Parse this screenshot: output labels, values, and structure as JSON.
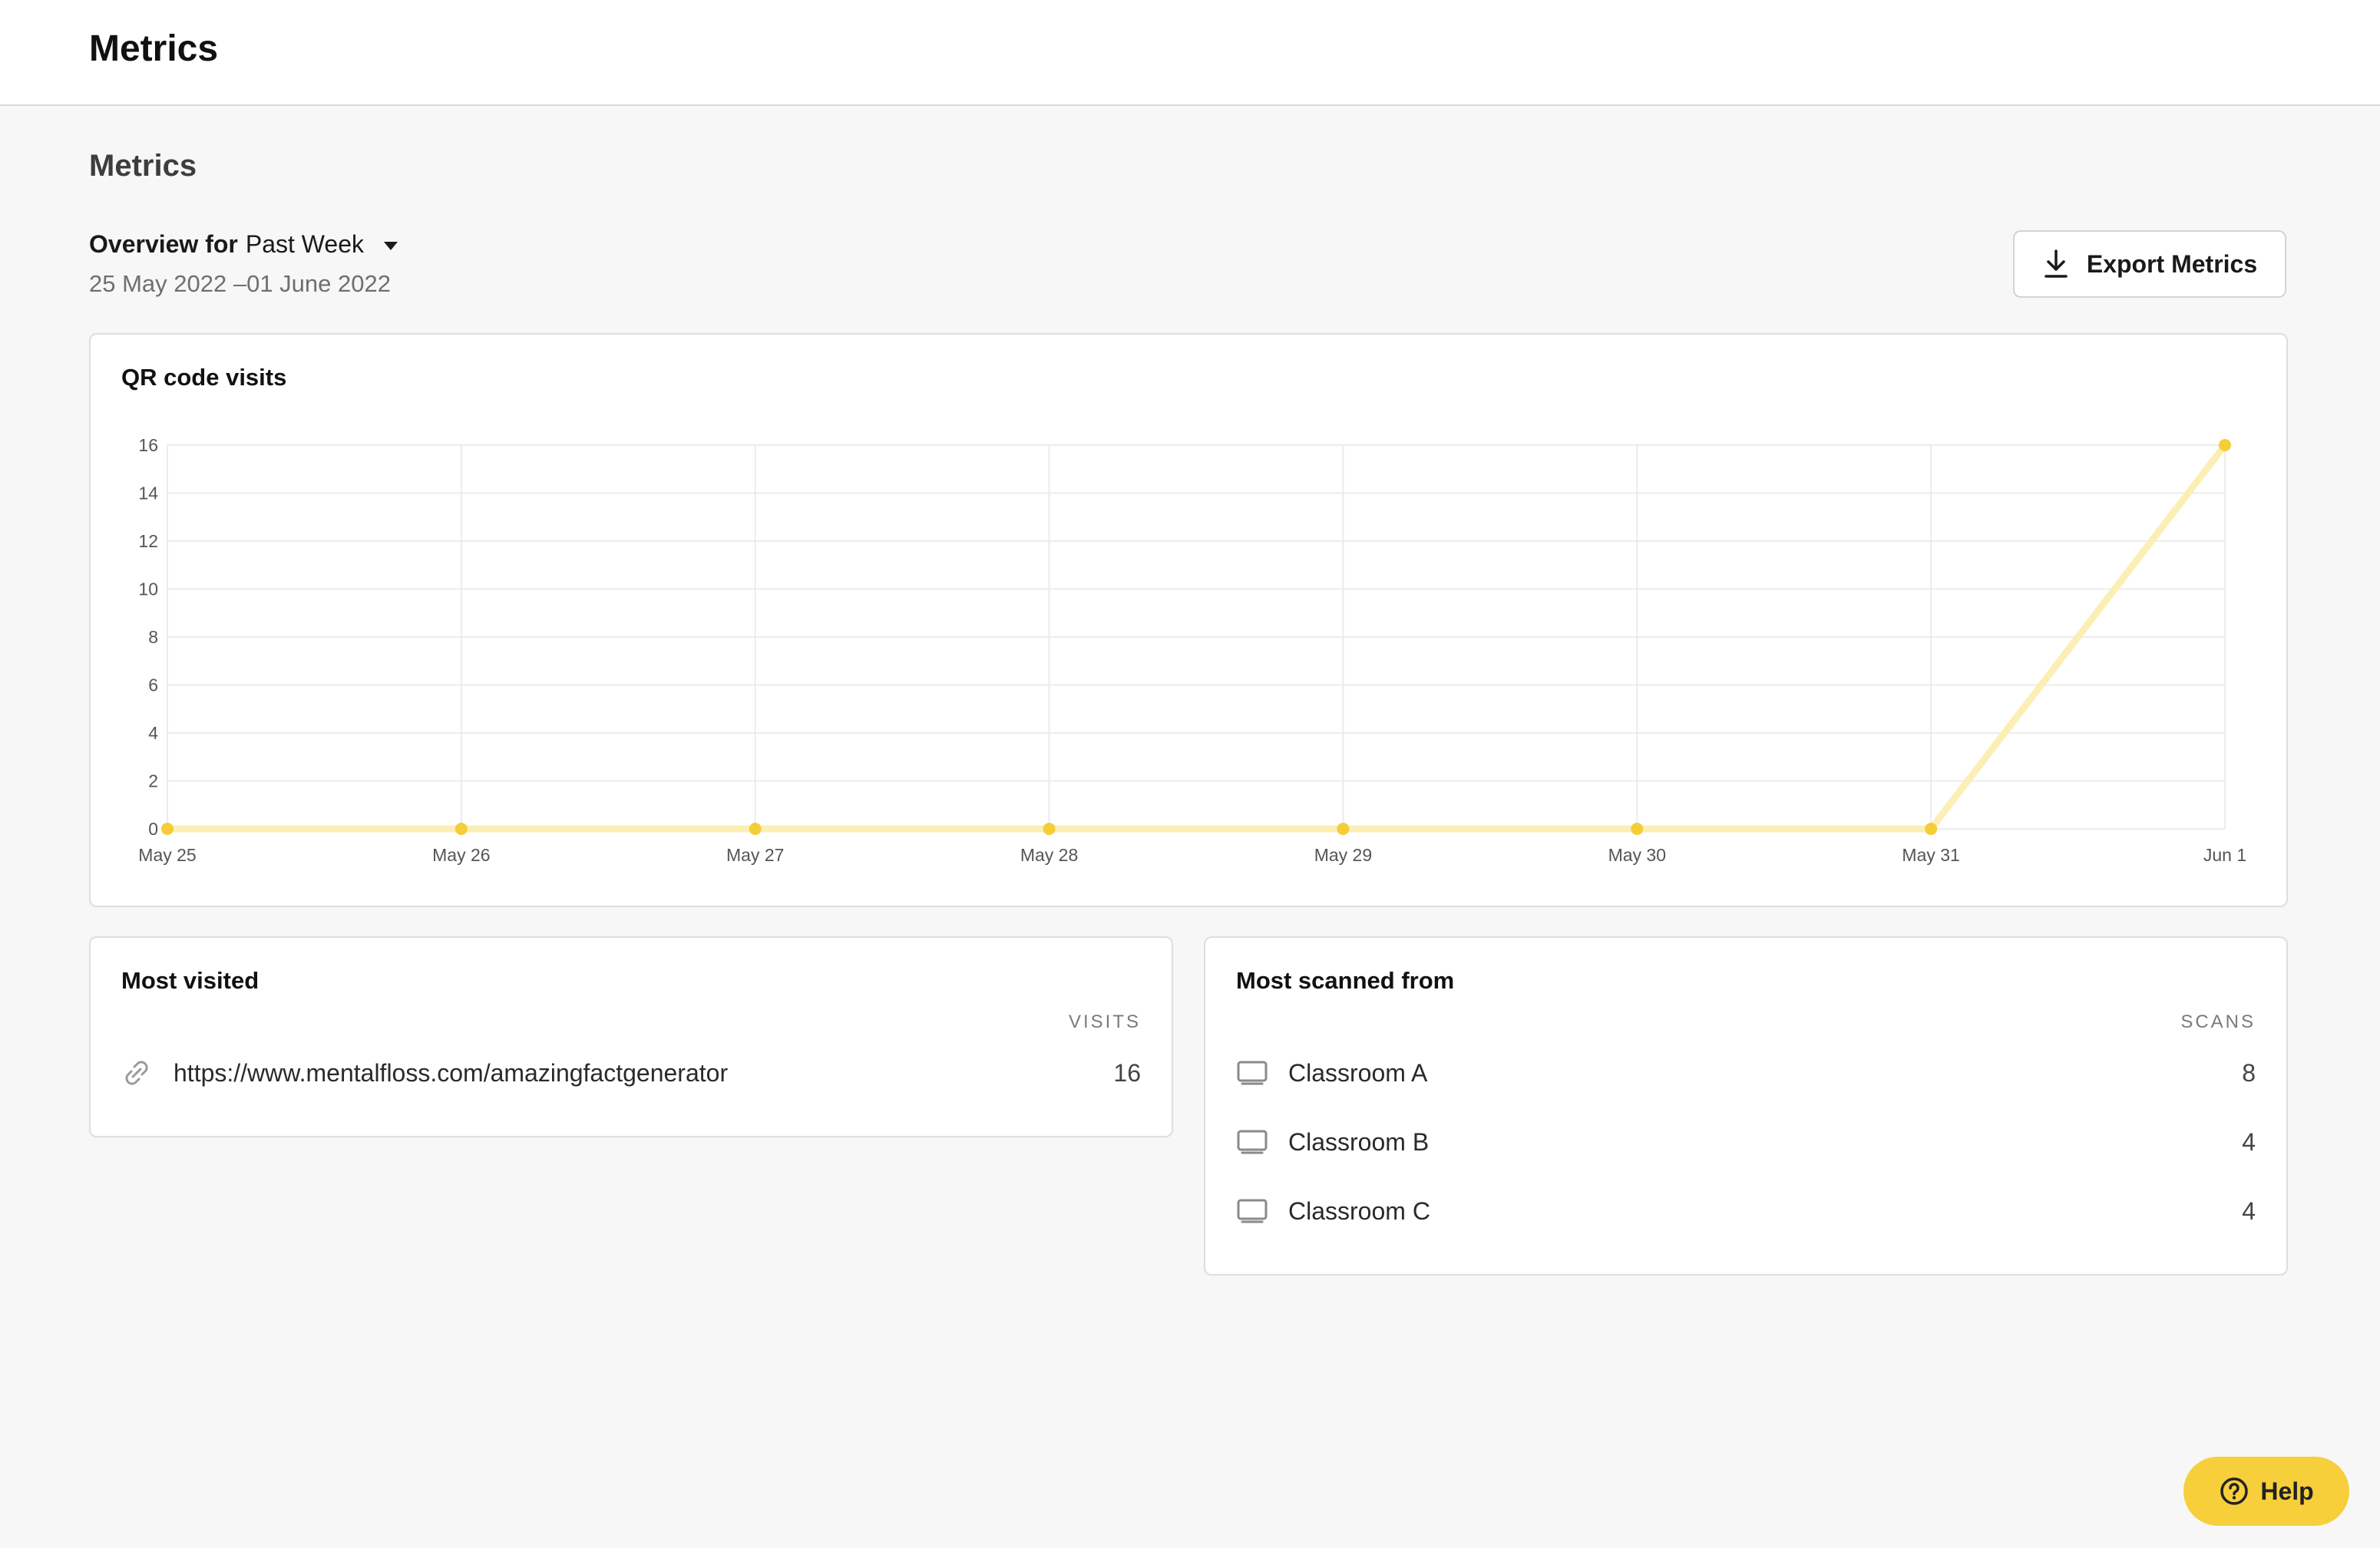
{
  "header": {
    "title": "Metrics"
  },
  "page": {
    "section_title": "Metrics",
    "overview_label": "Overview for",
    "period_selected": "Past Week",
    "date_range": "25 May 2022 –01 June 2022",
    "export_label": "Export Metrics"
  },
  "chart": {
    "title": "QR code visits"
  },
  "chart_data": {
    "type": "line",
    "title": "QR code visits",
    "xlabel": "",
    "ylabel": "",
    "categories": [
      "May 25",
      "May 26",
      "May 27",
      "May 28",
      "May 29",
      "May 30",
      "May 31",
      "Jun 1"
    ],
    "series": [
      {
        "values": [
          0,
          0,
          0,
          0,
          0,
          0,
          0,
          16
        ]
      }
    ],
    "ylim": [
      0,
      16
    ],
    "yticks": [
      0,
      2,
      4,
      6,
      8,
      10,
      12,
      14,
      16
    ],
    "grid": true,
    "legend": "none",
    "colors": {
      "line": "#fbefb5",
      "point": "#f5cd36"
    }
  },
  "most_visited": {
    "title": "Most visited",
    "column_header": "VISITS",
    "rows": [
      {
        "icon": "link-icon",
        "label": "https://www.mentalfloss.com/amazingfactgenerator",
        "value": "16"
      }
    ]
  },
  "most_scanned": {
    "title": "Most scanned from",
    "column_header": "SCANS",
    "rows": [
      {
        "icon": "display-icon",
        "label": "Classroom A",
        "value": "8"
      },
      {
        "icon": "display-icon",
        "label": "Classroom B",
        "value": "4"
      },
      {
        "icon": "display-icon",
        "label": "Classroom C",
        "value": "4"
      }
    ]
  },
  "help": {
    "label": "Help",
    "icon": "question-circle-icon"
  },
  "colors": {
    "accent": "#f6cf3b",
    "background": "#f7f7f7"
  }
}
